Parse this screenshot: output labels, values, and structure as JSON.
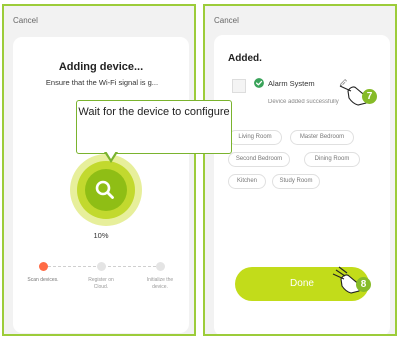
{
  "colors": {
    "accent": "#9ccc3a",
    "ring_inner": "#8fbe15",
    "ring_mid": "#c2d92e",
    "ring_outer": "#e7ef9b",
    "done_button": "#c2dc1a",
    "step_active": "#ff6b45",
    "badge": "#86bb28",
    "check": "#3aa35a"
  },
  "left_screen": {
    "cancel_label": "Cancel",
    "title": "Adding device...",
    "subtitle": "Ensure that the Wi-Fi signal is g...",
    "center_icon": "search-icon",
    "progress_percent": "10%",
    "progress_value": 0.1,
    "steps": [
      {
        "label": "Scan devices.",
        "state": "active"
      },
      {
        "label": "Register on Cloud.",
        "state": "pending"
      },
      {
        "label": "Initialize the device.",
        "state": "pending"
      }
    ],
    "callout": "Wait for the device to configure"
  },
  "right_screen": {
    "cancel_label": "Cancel",
    "title": "Added.",
    "device_name": "Alarm System",
    "device_status": "Device added successfully",
    "edit_icon": "pencil-icon",
    "rooms": [
      "Living Room",
      "Master Bedroom",
      "Second Bedroom",
      "Dining Room",
      "Kitchen",
      "Study Room"
    ],
    "done_label": "Done",
    "badge_edit": "7",
    "badge_done": "8"
  }
}
